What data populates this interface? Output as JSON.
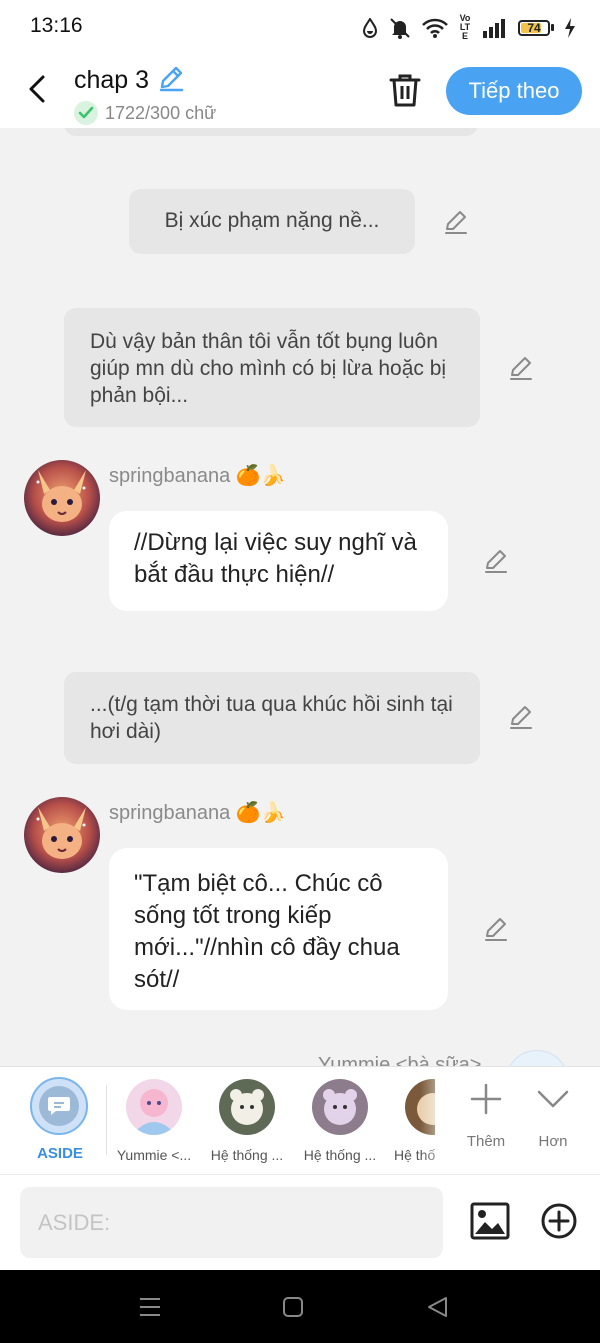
{
  "status_bar": {
    "time": "13:16",
    "battery": "74",
    "volte_label": "Vo LTE"
  },
  "header": {
    "title": "chap 3",
    "word_count": "1722/300 chữ",
    "next_label": "Tiếp theo"
  },
  "messages": [
    {
      "kind": "narration",
      "text": "Bị xúc phạm nặng nề..."
    },
    {
      "kind": "narration",
      "text": "Dù vậy bản thân tôi vẫn tốt bụng luôn giúp mn dù cho mình có bị lừa hoặc bị phản bội..."
    },
    {
      "kind": "character",
      "username": "springbanana 🍊🍌",
      "text": "//Dừng lại việc suy nghĩ và bắt đầu thực hiện//"
    },
    {
      "kind": "narration",
      "text": "...(t/g tạm thời tua qua khúc hồi sinh tại hơi dài)"
    },
    {
      "kind": "character",
      "username": "springbanana 🍊🍌",
      "text": "\"Tạm biệt cô... Chúc cô sống tốt trong kiếp mới...\"//nhìn cô đầy chua sót//"
    },
    {
      "kind": "character_partial",
      "username": "Yummie <bà sữa>"
    }
  ],
  "character_strip": {
    "aside_label": "ASIDE",
    "characters": [
      {
        "name": "Yummie <..."
      },
      {
        "name": "Hệ thống ..."
      },
      {
        "name": "Hệ thống ..."
      },
      {
        "name": "Hệ thố"
      }
    ],
    "more_label": "Thêm",
    "collapse_label": "Hơn"
  },
  "input_bar": {
    "placeholder": "ASIDE:"
  },
  "colors": {
    "accent": "#4aa3f2",
    "success": "#3cc46a",
    "bubble_gray": "#e6e6e6",
    "background": "#f2f2f2"
  }
}
